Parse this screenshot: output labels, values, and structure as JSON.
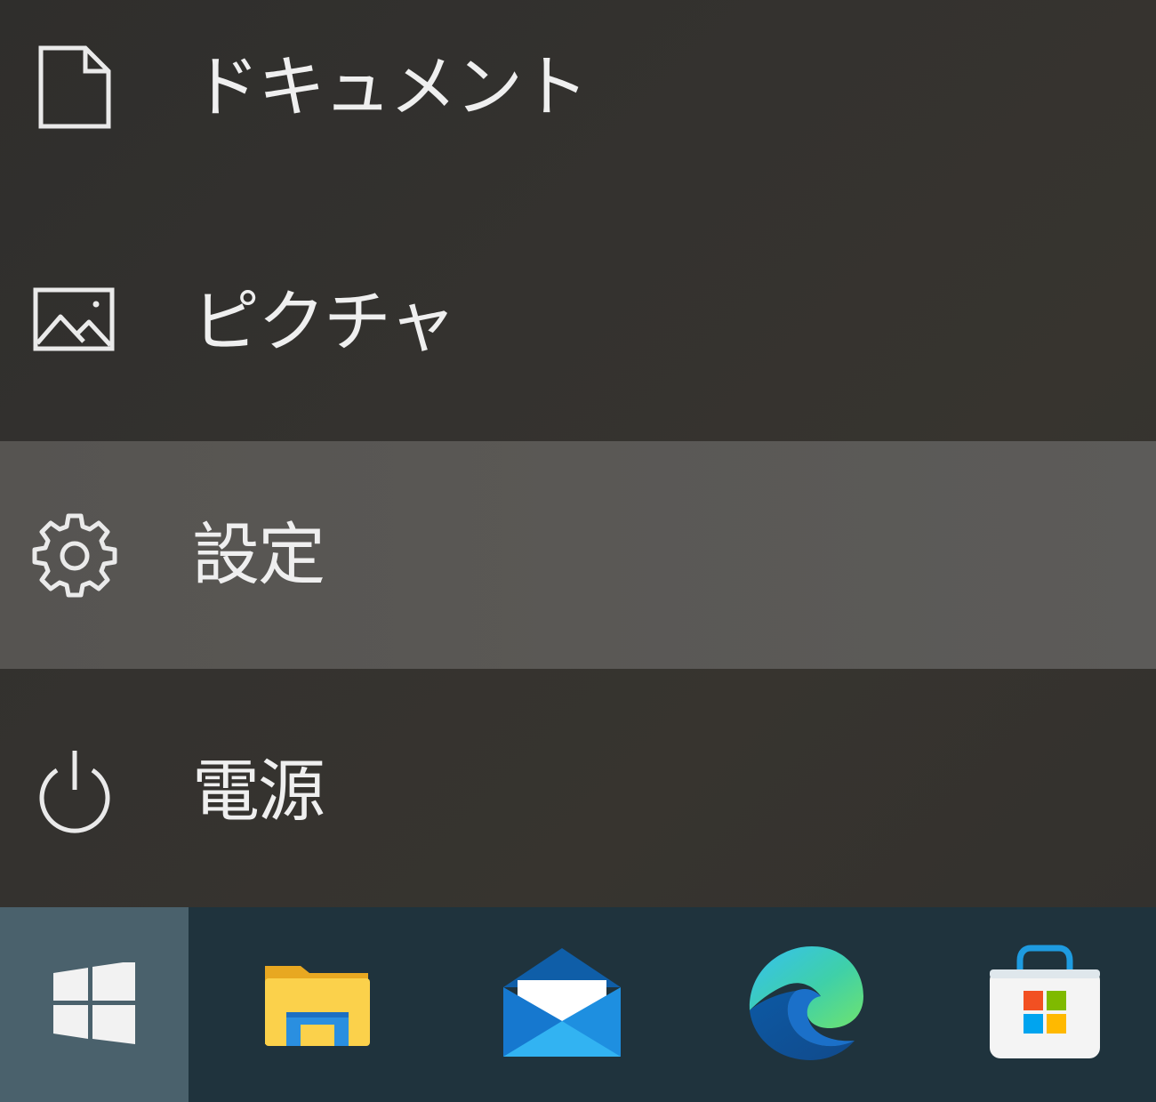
{
  "menu": {
    "items": [
      {
        "label": "ドキュメント",
        "icon": "document-icon"
      },
      {
        "label": "ピクチャ",
        "icon": "picture-icon"
      },
      {
        "label": "設定",
        "icon": "gear-icon",
        "hovered": true
      },
      {
        "label": "電源",
        "icon": "power-icon"
      }
    ]
  },
  "taskbar": {
    "start_icon": "windows-logo-icon",
    "apps": [
      {
        "icon": "file-explorer-icon"
      },
      {
        "icon": "mail-icon"
      },
      {
        "icon": "edge-icon"
      },
      {
        "icon": "microsoft-store-icon"
      }
    ]
  },
  "colors": {
    "menu_background": "#33312e",
    "hover_background": "#5a5855",
    "taskbar_background": "#1f333d",
    "start_button_background": "#4a616c",
    "text": "#efefef"
  }
}
